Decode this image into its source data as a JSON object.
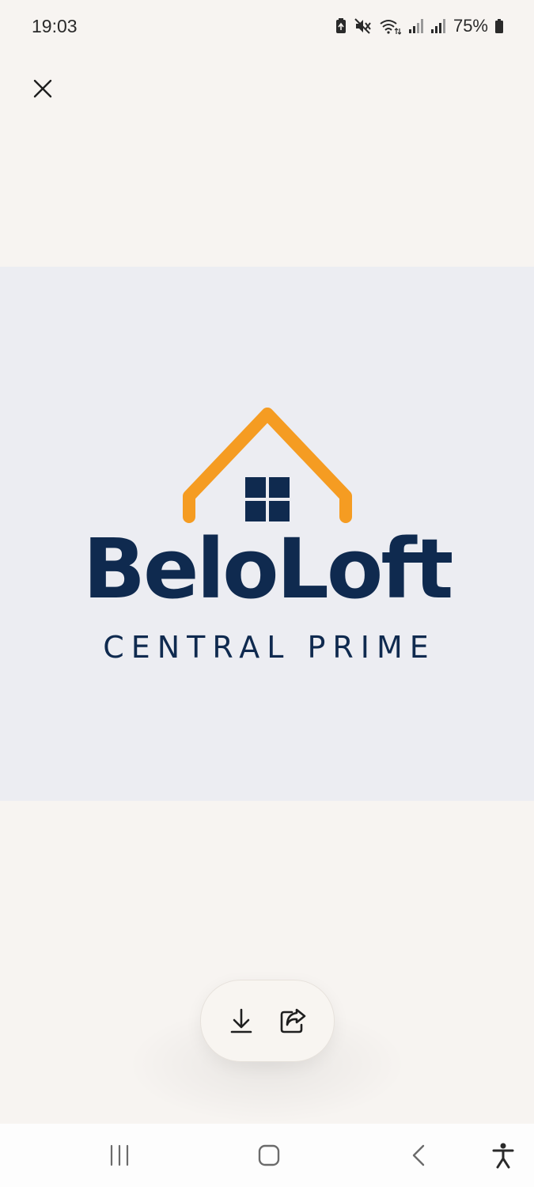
{
  "status_bar": {
    "time": "19:03",
    "battery_percent": "75%",
    "icons": [
      "battery-saver-icon",
      "mute-icon",
      "wifi-icon",
      "signal-icon",
      "signal-icon",
      "battery-icon"
    ]
  },
  "viewer": {
    "close_icon": "close-icon"
  },
  "image": {
    "brand_name": "BeloLoft",
    "brand_subtitle": "CENTRAL PRIME",
    "colors": {
      "background": "#ecedf2",
      "brand_navy": "#0f2a4f",
      "roof_orange": "#f59c22"
    }
  },
  "actions": {
    "icons": [
      "download-icon",
      "share-icon"
    ]
  },
  "nav_bar": {
    "icons": [
      "recent-apps-icon",
      "home-icon",
      "back-icon",
      "accessibility-icon"
    ]
  }
}
